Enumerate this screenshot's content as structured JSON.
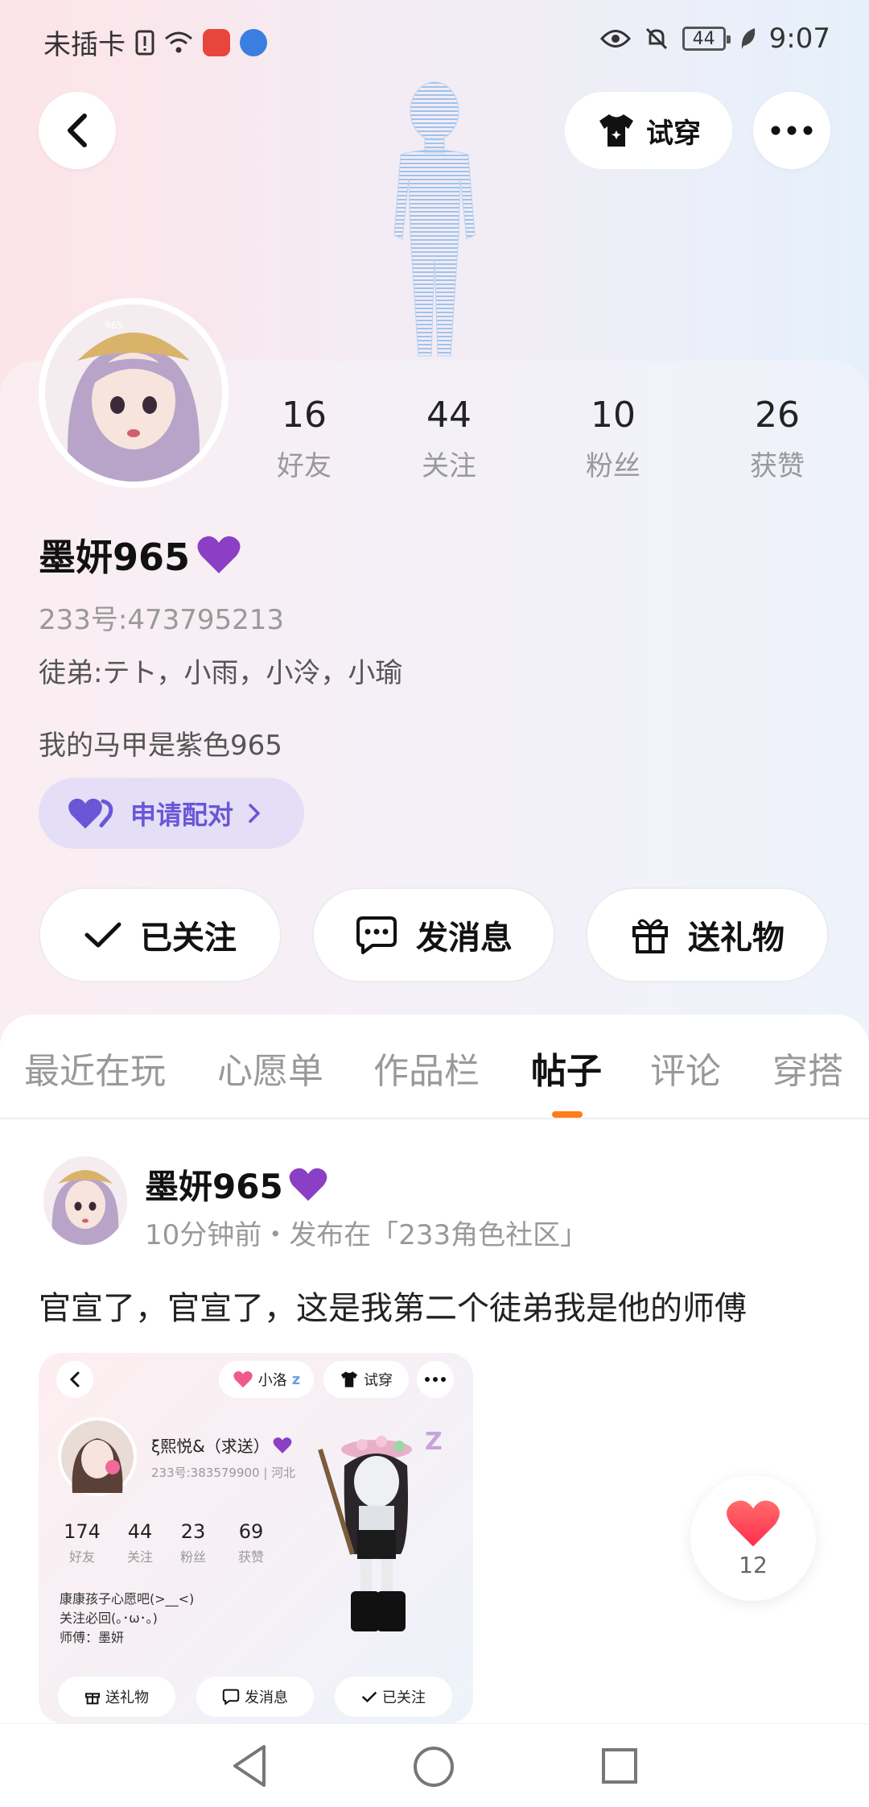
{
  "status_bar": {
    "carrier": "未插卡",
    "battery": "44",
    "time": "9:07"
  },
  "top_bar": {
    "try_on_label": "试穿"
  },
  "profile": {
    "stats": [
      {
        "value": "16",
        "label": "好友"
      },
      {
        "value": "44",
        "label": "关注"
      },
      {
        "value": "10",
        "label": "粉丝"
      },
      {
        "value": "26",
        "label": "获赞"
      }
    ],
    "name": "墨妍965",
    "id_line": "233号:473795213",
    "apprentices": "徒弟:テト，小雨，小泠，小瑜",
    "bio": "我的马甲是紫色965",
    "pair_button": "申请配对",
    "actions": {
      "follow": "已关注",
      "message": "发消息",
      "gift": "送礼物"
    },
    "avatar_badge": "965"
  },
  "tabs": [
    {
      "label": "最近在玩",
      "active": false
    },
    {
      "label": "心愿单",
      "active": false
    },
    {
      "label": "作品栏",
      "active": false
    },
    {
      "label": "帖子",
      "active": true
    },
    {
      "label": "评论",
      "active": false
    },
    {
      "label": "穿搭",
      "active": false
    }
  ],
  "post": {
    "author": "墨妍965",
    "meta": "10分钟前・发布在「233角色社区」",
    "text": "官宣了，官宣了，这是我第二个徒弟我是他的师傅",
    "likes": "12",
    "image": {
      "pet_label": "小洛",
      "try_on_label": "试穿",
      "name": "ξ熙悦&（求送）",
      "id_line": "233号:383579900 | 河北",
      "stats": [
        {
          "value": "174",
          "label": "好友"
        },
        {
          "value": "44",
          "label": "关注"
        },
        {
          "value": "23",
          "label": "粉丝"
        },
        {
          "value": "69",
          "label": "获赞"
        }
      ],
      "bio_lines": [
        "康康孩子心愿吧(>__<)",
        "关注必回(｡･ω･｡)",
        "师傅：墨妍"
      ],
      "buttons": {
        "gift": "送礼物",
        "message": "发消息",
        "follow": "已关注"
      }
    }
  },
  "colors": {
    "accent_orange": "#ff7a1a",
    "pair_purple": "#6a56d6",
    "heart_red": "#ff3b4a"
  }
}
